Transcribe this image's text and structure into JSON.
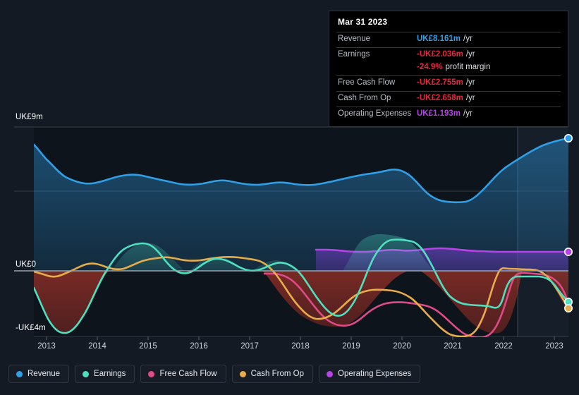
{
  "tooltip": {
    "title": "Mar 31 2023",
    "rows": [
      {
        "label": "Revenue",
        "value": "UK£8.161m",
        "color": "#2f9fe8",
        "suffix": "/yr"
      },
      {
        "label": "Earnings",
        "value": "-UK£2.036m",
        "color": "#e8273d",
        "suffix": "/yr"
      },
      {
        "label": "",
        "value": "-24.9%",
        "color": "#e8273d",
        "suffix": "profit margin"
      },
      {
        "label": "Free Cash Flow",
        "value": "-UK£2.755m",
        "color": "#e8273d",
        "suffix": "/yr"
      },
      {
        "label": "Cash From Op",
        "value": "-UK£2.658m",
        "color": "#e8273d",
        "suffix": "/yr"
      },
      {
        "label": "Operating Expenses",
        "value": "UK£1.193m",
        "color": "#b742e8",
        "suffix": "/yr"
      }
    ]
  },
  "axes": {
    "y_top_label": "UK£9m",
    "y_zero_label": "UK£0",
    "y_bottom_label": "-UK£4m",
    "x_ticks": [
      "2013",
      "2014",
      "2015",
      "2016",
      "2017",
      "2018",
      "2019",
      "2020",
      "2021",
      "2022",
      "2023"
    ]
  },
  "legend": [
    {
      "label": "Revenue",
      "color": "#2f9fe8"
    },
    {
      "label": "Earnings",
      "color": "#4fe0c0"
    },
    {
      "label": "Free Cash Flow",
      "color": "#e04a86"
    },
    {
      "label": "Cash From Op",
      "color": "#e8ad4a"
    },
    {
      "label": "Operating Expenses",
      "color": "#b742e8"
    }
  ],
  "chart_data": {
    "type": "line",
    "title": "",
    "xlabel": "",
    "ylabel": "UK£ (millions)",
    "ylim": [
      -4,
      9
    ],
    "xlim": [
      2012.75,
      2023.0
    ],
    "grid": true,
    "legend_position": "bottom",
    "currency": "UK£",
    "unit": "m",
    "forecast_boundary_x": 2022.28,
    "annotations": [
      "Mar 31 2023"
    ],
    "series": [
      {
        "name": "Revenue",
        "color": "#2f9fe8",
        "x": [
          2012.75,
          2013.0,
          2013.25,
          2013.5,
          2013.75,
          2014.0,
          2014.25,
          2014.5,
          2014.75,
          2015.0,
          2015.25,
          2015.5,
          2015.75,
          2016.0,
          2016.25,
          2016.5,
          2016.75,
          2017.0,
          2017.25,
          2017.5,
          2017.75,
          2018.0,
          2018.25,
          2018.5,
          2018.75,
          2019.0,
          2019.25,
          2019.5,
          2019.75,
          2020.0,
          2020.25,
          2020.5,
          2020.75,
          2021.0,
          2021.25,
          2021.5,
          2021.75,
          2022.0,
          2022.25,
          2022.5,
          2022.75,
          2023.0
        ],
        "y": [
          7.95,
          7.62,
          7.38,
          7.26,
          7.28,
          7.22,
          7.3,
          7.38,
          7.42,
          7.36,
          7.28,
          7.2,
          7.14,
          7.06,
          7.14,
          7.2,
          7.14,
          7.06,
          7.0,
          7.04,
          7.12,
          7.06,
          7.02,
          7.04,
          7.1,
          7.18,
          7.24,
          7.3,
          7.34,
          7.4,
          7.2,
          6.7,
          6.3,
          6.18,
          6.14,
          6.42,
          6.98,
          7.44,
          7.7,
          7.88,
          8.04,
          8.16
        ]
      },
      {
        "name": "Earnings",
        "color": "#4fe0c0",
        "x": [
          2012.75,
          2013.0,
          2013.25,
          2013.5,
          2013.75,
          2014.0,
          2014.25,
          2014.5,
          2014.75,
          2015.0,
          2015.25,
          2015.5,
          2015.75,
          2016.0,
          2016.25,
          2016.5,
          2016.75,
          2017.0,
          2017.25,
          2017.5,
          2017.75,
          2018.0,
          2018.25,
          2018.5,
          2018.75,
          2019.0,
          2019.25,
          2019.5,
          2019.75,
          2020.0,
          2020.25,
          2020.5,
          2020.75,
          2021.0,
          2021.25,
          2021.5,
          2021.75,
          2022.0,
          2022.25,
          2022.5,
          2022.75,
          2023.0
        ],
        "y": [
          -1.05,
          -2.3,
          -3.45,
          -3.85,
          -3.1,
          -1.55,
          -0.15,
          0.85,
          1.12,
          1.1,
          0.45,
          -0.1,
          0.15,
          0.55,
          0.8,
          0.62,
          0.25,
          0.08,
          0.2,
          0.45,
          0.35,
          -0.15,
          -0.95,
          -1.7,
          -2.28,
          -2.45,
          -1.95,
          -0.45,
          0.95,
          1.18,
          1.12,
          1.05,
          -0.3,
          -1.4,
          -1.55,
          -1.62,
          -1.7,
          -1.85,
          -0.35,
          -0.25,
          -0.28,
          -2.04
        ]
      },
      {
        "name": "Free Cash Flow",
        "color": "#e04a86",
        "x": [
          2017.4,
          2017.5,
          2017.75,
          2018.0,
          2018.25,
          2018.5,
          2018.75,
          2019.0,
          2019.25,
          2019.5,
          2019.75,
          2020.0,
          2020.25,
          2020.5,
          2020.75,
          2021.0,
          2021.25,
          2021.5,
          2021.75,
          2022.0,
          2022.25,
          2022.5,
          2022.75,
          2023.0
        ],
        "y": [
          -0.18,
          -0.18,
          -0.2,
          -0.55,
          -1.35,
          -2.35,
          -2.85,
          -2.7,
          -2.15,
          -1.7,
          -1.55,
          -1.55,
          -1.62,
          -1.7,
          -2.3,
          -3.15,
          -3.75,
          -4.0,
          -3.55,
          -0.12,
          -0.18,
          -0.22,
          -0.3,
          -2.76
        ]
      },
      {
        "name": "Cash From Op",
        "color": "#e8ad4a",
        "x": [
          2012.75,
          2013.0,
          2013.25,
          2013.5,
          2013.75,
          2014.0,
          2014.25,
          2014.5,
          2014.75,
          2015.0,
          2015.25,
          2015.5,
          2015.75,
          2016.0,
          2016.25,
          2016.5,
          2016.75,
          2017.0,
          2017.25,
          2017.5,
          2017.75,
          2018.0,
          2018.25,
          2018.5,
          2018.75,
          2019.0,
          2019.25,
          2019.5,
          2019.75,
          2020.0,
          2020.25,
          2020.5,
          2020.75,
          2021.0,
          2021.25,
          2021.5,
          2021.75,
          2022.0,
          2022.25,
          2022.5,
          2022.75,
          2023.0
        ],
        "y": [
          -0.05,
          -0.12,
          -0.22,
          -0.3,
          -0.22,
          -0.05,
          0.12,
          0.28,
          0.22,
          0.05,
          0.15,
          0.32,
          0.45,
          0.52,
          0.56,
          0.5,
          0.42,
          0.48,
          0.56,
          0.58,
          0.52,
          0.1,
          -0.85,
          -1.85,
          -2.55,
          -2.95,
          -2.55,
          -1.7,
          -1.3,
          -1.2,
          -1.15,
          -1.18,
          -1.9,
          -2.9,
          -3.6,
          -3.95,
          -3.7,
          0.12,
          0.1,
          0.08,
          -0.02,
          -2.66
        ]
      },
      {
        "name": "Operating Expenses",
        "color": "#b742e8",
        "x": [
          2018.3,
          2018.5,
          2018.75,
          2019.0,
          2019.25,
          2019.5,
          2019.75,
          2020.0,
          2020.25,
          2020.5,
          2020.75,
          2021.0,
          2021.25,
          2021.5,
          2021.75,
          2022.0,
          2022.25,
          2022.5,
          2022.75,
          2023.0
        ],
        "y": [
          1.32,
          1.32,
          1.3,
          1.26,
          1.22,
          1.2,
          1.22,
          1.26,
          1.22,
          1.2,
          1.24,
          1.3,
          1.26,
          1.22,
          1.2,
          1.2,
          1.19,
          1.19,
          1.19,
          1.19
        ]
      }
    ],
    "end_markers": [
      {
        "series": "Revenue",
        "value": 8.161
      },
      {
        "series": "Operating Expenses",
        "value": 1.193
      },
      {
        "series": "Earnings",
        "value": -2.036
      },
      {
        "series": "Cash From Op",
        "value": -2.658
      }
    ]
  }
}
